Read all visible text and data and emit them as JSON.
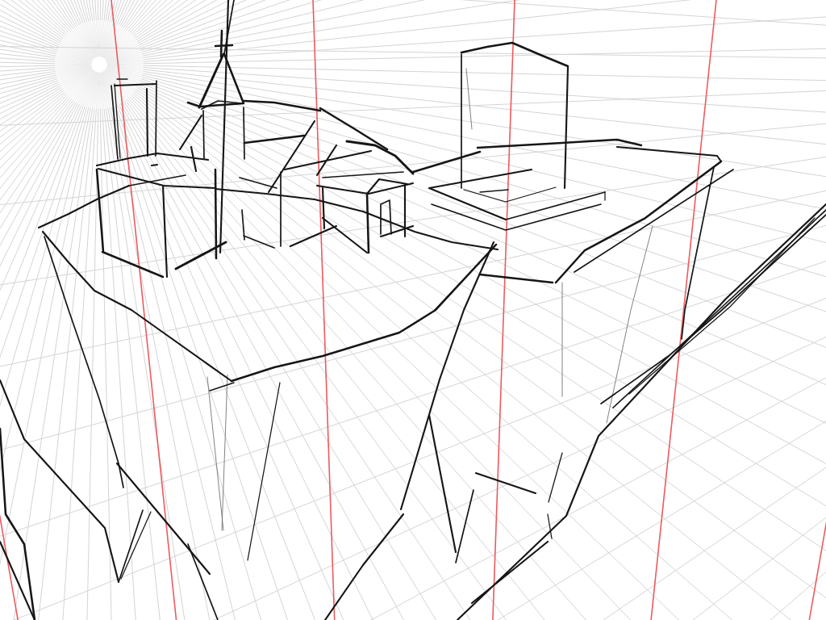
{
  "canvas": {
    "layers": [
      {
        "kind": "grid"
      },
      {
        "kind": "guides"
      },
      {
        "kind": "sketch"
      }
    ]
  }
}
